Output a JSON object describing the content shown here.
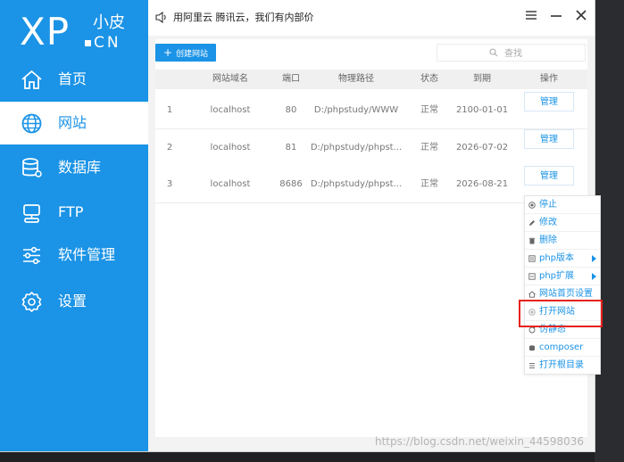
{
  "logo": {
    "main": "XP",
    "top": "小皮",
    "bottom": "CN"
  },
  "sidebar": {
    "items": [
      {
        "label": "首页",
        "icon": "home-icon"
      },
      {
        "label": "网站",
        "icon": "globe-icon",
        "active": true
      },
      {
        "label": "数据库",
        "icon": "database-icon"
      },
      {
        "label": "FTP",
        "icon": "monitor-icon"
      },
      {
        "label": "软件管理",
        "icon": "sliders-icon"
      },
      {
        "label": "设置",
        "icon": "gear-icon"
      }
    ]
  },
  "topbar": {
    "notice": "用阿里云 腾讯云，我们有内部价"
  },
  "toolbar": {
    "create_label": "创建网站",
    "search_placeholder": "查找"
  },
  "table": {
    "headers": [
      "网站域名",
      "端口",
      "物理路径",
      "状态",
      "到期",
      "操作"
    ],
    "rows": [
      {
        "index": "1",
        "domain": "localhost",
        "port": "80",
        "path": "D:/phpstudy/WWW",
        "status": "正常",
        "expiry": "2100-01-01",
        "action": "管理"
      },
      {
        "index": "2",
        "domain": "localhost",
        "port": "81",
        "path": "D:/phpstudy/phpst...",
        "status": "正常",
        "expiry": "2026-07-02",
        "action": "管理"
      },
      {
        "index": "3",
        "domain": "localhost",
        "port": "8686",
        "path": "D:/phpstudy/phpst...",
        "status": "正常",
        "expiry": "2026-08-21",
        "action": "管理"
      }
    ]
  },
  "context_menu": {
    "items": [
      {
        "label": "停止",
        "icon": "stop-icon"
      },
      {
        "label": "修改",
        "icon": "edit-icon"
      },
      {
        "label": "删除",
        "icon": "trash-icon"
      },
      {
        "label": "php版本",
        "icon": "php-version-icon",
        "submenu": true
      },
      {
        "label": "php扩展",
        "icon": "php-extension-icon",
        "submenu": true
      },
      {
        "label": "网站首页设置",
        "icon": "home-small-icon"
      },
      {
        "label": "打开网站",
        "icon": "globe-small-icon",
        "highlighted": true
      },
      {
        "label": "伪静态",
        "icon": "rewrite-icon"
      },
      {
        "label": "composer",
        "icon": "composer-icon"
      },
      {
        "label": "打开根目录",
        "icon": "folder-list-icon"
      }
    ]
  },
  "watermark": "https://blog.csdn.net/weixin_44598036",
  "colors": {
    "accent": "#1b93e6",
    "highlight_border": "#e6221a"
  }
}
